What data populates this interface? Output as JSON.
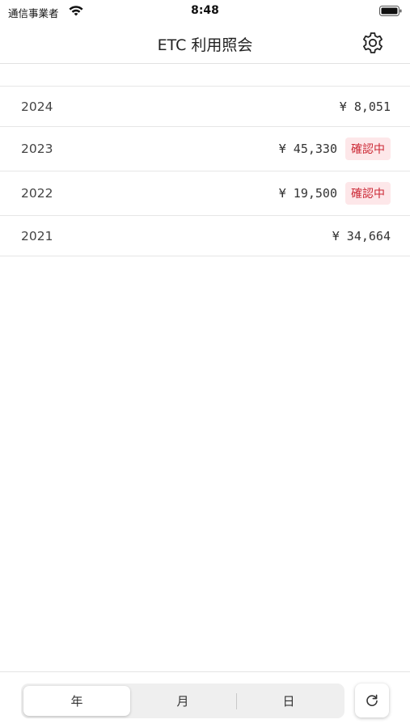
{
  "status_bar": {
    "carrier": "通信事業者",
    "time": "8:48"
  },
  "header": {
    "title": "ETC 利用照会",
    "settings_icon": "gear-icon"
  },
  "years": [
    {
      "year": "2024",
      "amount": "¥ 8,051",
      "badge": ""
    },
    {
      "year": "2023",
      "amount": "¥ 45,330",
      "badge": "確認中"
    },
    {
      "year": "2022",
      "amount": "¥ 19,500",
      "badge": "確認中"
    },
    {
      "year": "2021",
      "amount": "¥ 34,664",
      "badge": ""
    }
  ],
  "period_selector": {
    "segments": [
      "年",
      "月",
      "日"
    ],
    "selected": "年"
  },
  "refresh_icon": "refresh-icon",
  "colors": {
    "badge_background": "#fde7e9",
    "badge_text": "#cc2a36",
    "segment_background": "#efefef"
  }
}
